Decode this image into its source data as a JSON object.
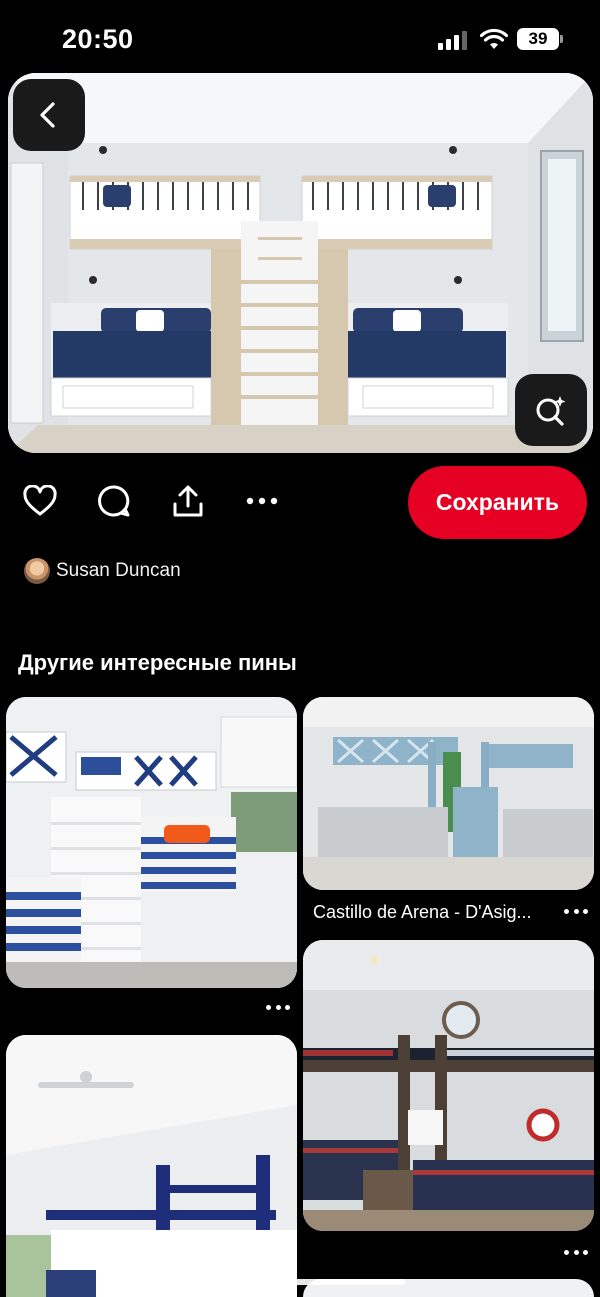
{
  "status_bar": {
    "time": "20:50",
    "battery": "39"
  },
  "hero": {
    "icons": {
      "back": "chevron-left-icon",
      "visual_search": "lens-search-icon"
    }
  },
  "actions": {
    "icons": [
      "heart-icon",
      "comment-icon",
      "share-icon",
      "more-dots-icon"
    ],
    "save_label": "Сохранить",
    "save_color": "#e60023"
  },
  "author": {
    "name": "Susan Duncan"
  },
  "section": {
    "title": "Другие интересные пины"
  },
  "pins": [
    {
      "caption": ""
    },
    {
      "caption": "Castillo de Arena - D'Asig..."
    },
    {
      "caption": ""
    },
    {
      "caption": ""
    },
    {
      "caption": ""
    }
  ]
}
